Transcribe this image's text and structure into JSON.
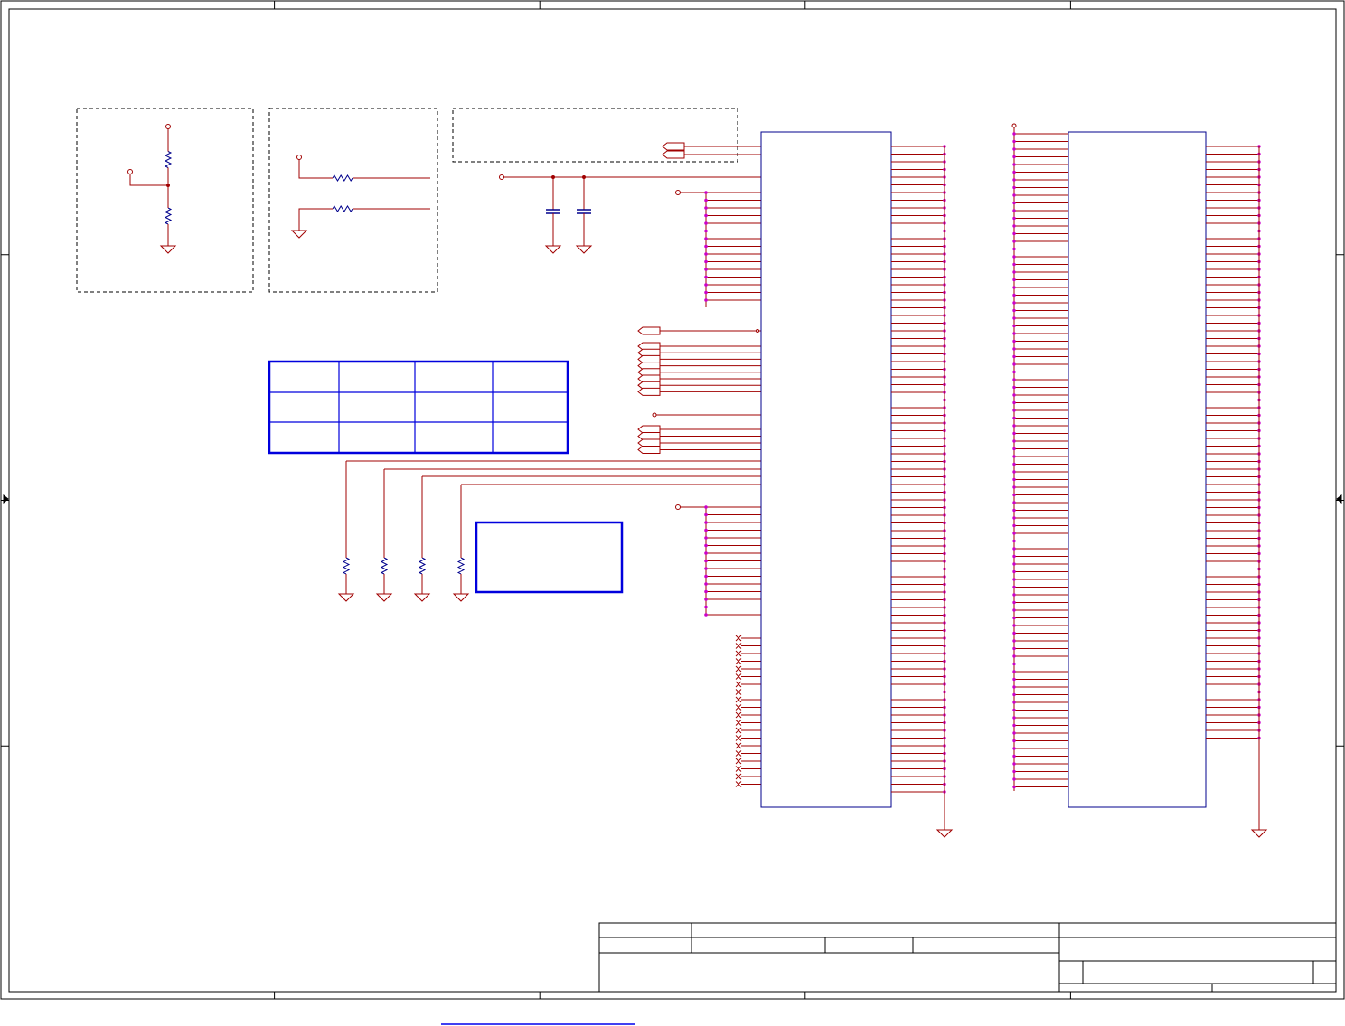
{
  "sheet": {
    "border_color": "#000000",
    "wire_color": "#a00000",
    "symbol_color": "#00008c",
    "table_color": "#0000dd",
    "pin_marker_color": "#cc00cc",
    "zone_columns": 5,
    "zone_rows": 4
  },
  "groups": {
    "dashed_boxes": 3,
    "divider_resistors": 2,
    "series_resistors": 2,
    "decoupling_capacitors": 2,
    "pulldown_resistors": 4,
    "unconnected_pins": 20
  },
  "connectors": {
    "left": {
      "left_pins": 88,
      "right_pins": 85
    },
    "right": {
      "left_pins": 86,
      "right_pins": 78
    }
  },
  "config_table": {
    "rows": 3,
    "columns": 4,
    "cells": []
  },
  "title_block": {
    "fields": []
  },
  "footer": {
    "link_text": ""
  }
}
